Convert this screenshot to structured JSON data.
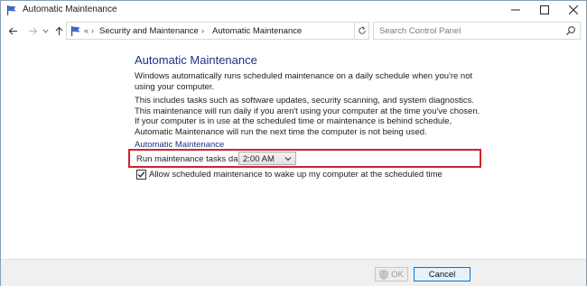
{
  "window": {
    "title": "Automatic Maintenance"
  },
  "nav": {
    "back_icon": "arrow-left-icon",
    "forward_icon": "arrow-right-icon",
    "up_icon": "arrow-up-icon"
  },
  "address": {
    "overflow": "«",
    "crumbs": [
      "Security and Maintenance",
      "Automatic Maintenance"
    ],
    "separator": "›"
  },
  "search": {
    "placeholder": "Search Control Panel"
  },
  "content": {
    "title": "Automatic Maintenance",
    "intro": "Windows automatically runs scheduled maintenance on a daily schedule when you're not using your computer.",
    "details": "This includes tasks such as software updates, security scanning, and system diagnostics. This maintenance will run daily if you aren't using your computer at the time you've chosen. If your computer is in use at the scheduled time or maintenance is behind schedule, Automatic Maintenance will run the next time the computer is not being used.",
    "group_label": "Automatic Maintenance",
    "run_label": "Run maintenance tasks daily at",
    "run_time": "2:00 AM",
    "wake_label": "Allow scheduled maintenance to wake up my computer at the scheduled time",
    "wake_checked": true
  },
  "footer": {
    "ok_label": "OK",
    "cancel_label": "Cancel"
  },
  "colors": {
    "heading": "#1e3287",
    "highlight": "#d4202c",
    "focus_border": "#0078d7"
  }
}
